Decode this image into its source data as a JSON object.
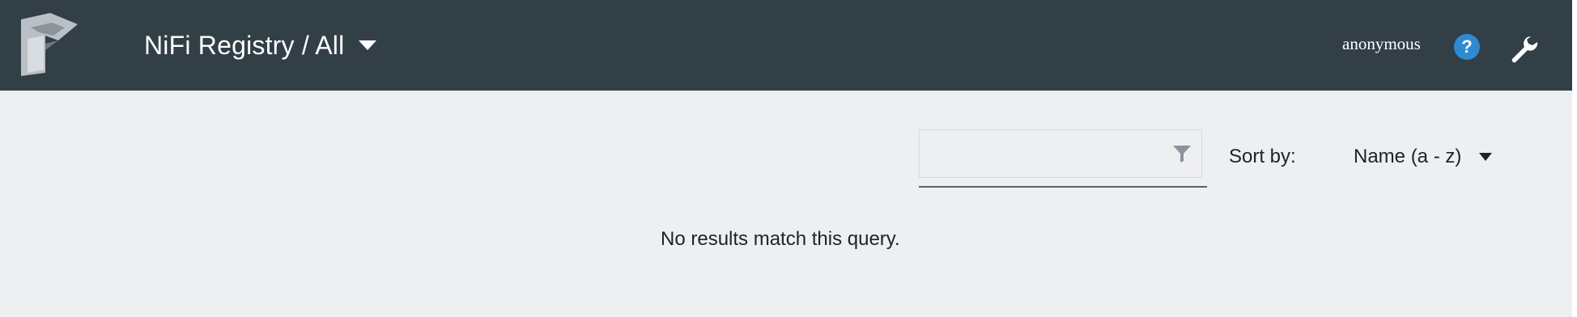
{
  "header": {
    "brand_title": "NiFi Registry / All",
    "user": "anonymous",
    "icons": {
      "logo": "nifi-registry-logo",
      "brand_caret": "caret-down-icon",
      "help": "help-circle-icon",
      "settings": "wrench-icon"
    }
  },
  "toolbar": {
    "filter": {
      "value": "",
      "placeholder": "",
      "icon": "filter-funnel-icon"
    },
    "sort": {
      "label": "Sort by:",
      "selected": "Name (a - z)",
      "icon": "caret-down-icon"
    }
  },
  "results": {
    "empty_message": "No results match this query."
  },
  "colors": {
    "header_bg": "#323f47",
    "content_bg": "#eeeff1",
    "help_blue": "#2f8bd1",
    "text_dark": "#1e2328"
  }
}
